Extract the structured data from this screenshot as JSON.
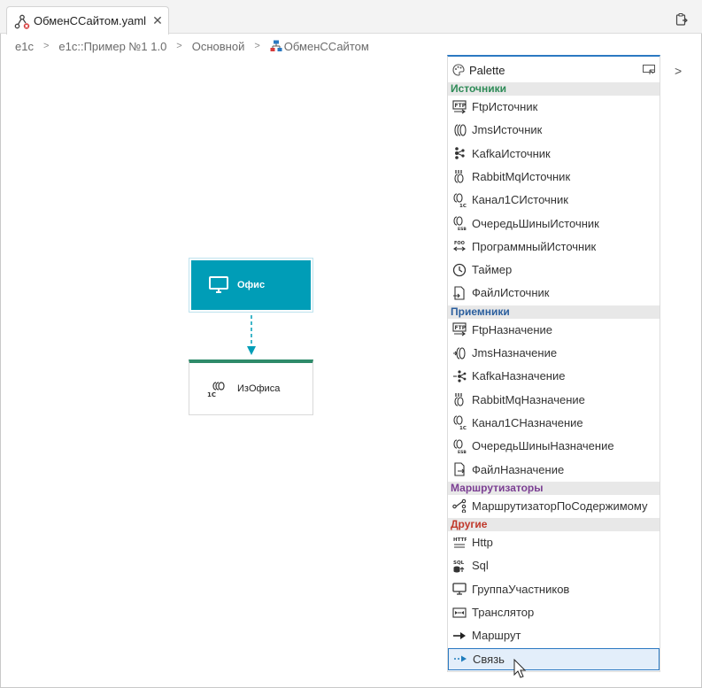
{
  "tab": {
    "title": "ОбменССайтом.yaml",
    "close": "✕"
  },
  "breadcrumb": [
    "e1c",
    "e1c::Пример №1 1.0",
    "Основной",
    "ОбменССайтом"
  ],
  "canvas": {
    "source_node": {
      "label": "Офис",
      "icon": "monitor-icon"
    },
    "dest_node": {
      "label": "ИзОфиса",
      "icon": "1c-channel-destination-icon"
    }
  },
  "palette": {
    "title": "Palette",
    "sections": [
      {
        "title": "Источники",
        "color": "#2e8b57",
        "items": [
          {
            "label": "FtpИсточник",
            "icon": "ftp-source-icon"
          },
          {
            "label": "JmsИсточник",
            "icon": "jms-source-icon"
          },
          {
            "label": "KafkaИсточник",
            "icon": "kafka-source-icon"
          },
          {
            "label": "RabbitMqИсточник",
            "icon": "rabbitmq-source-icon"
          },
          {
            "label": "Канал1СИсточник",
            "icon": "1c-channel-source-icon"
          },
          {
            "label": "ОчередьШиныИсточник",
            "icon": "esb-queue-source-icon"
          },
          {
            "label": "ПрограммныйИсточник",
            "icon": "program-source-icon"
          },
          {
            "label": "Таймер",
            "icon": "timer-icon"
          },
          {
            "label": "ФайлИсточник",
            "icon": "file-source-icon"
          }
        ]
      },
      {
        "title": "Приемники",
        "color": "#2b5f9e",
        "items": [
          {
            "label": "FtpНазначение",
            "icon": "ftp-destination-icon"
          },
          {
            "label": "JmsНазначение",
            "icon": "jms-destination-icon"
          },
          {
            "label": "KafkaНазначение",
            "icon": "kafka-destination-icon"
          },
          {
            "label": "RabbitMqНазначение",
            "icon": "rabbitmq-destination-icon"
          },
          {
            "label": "Канал1СНазначение",
            "icon": "1c-channel-destination-icon"
          },
          {
            "label": "ОчередьШиныНазначение",
            "icon": "esb-queue-destination-icon"
          },
          {
            "label": "ФайлНазначение",
            "icon": "file-destination-icon"
          }
        ]
      },
      {
        "title": "Маршрутизаторы",
        "color": "#7b3f93",
        "items": [
          {
            "label": "МаршрутизаторПоСодержимому",
            "icon": "content-router-icon"
          }
        ]
      },
      {
        "title": "Другие",
        "color": "#c0392b",
        "items": [
          {
            "label": "Http",
            "icon": "http-icon"
          },
          {
            "label": "Sql",
            "icon": "sql-icon"
          },
          {
            "label": "ГруппаУчастников",
            "icon": "participant-group-icon"
          },
          {
            "label": "Транслятор",
            "icon": "translator-icon"
          },
          {
            "label": "Маршрут",
            "icon": "route-arrow-icon"
          },
          {
            "label": "Связь",
            "icon": "link-dashed-arrow-icon",
            "selected": true
          }
        ]
      }
    ]
  },
  "colors": {
    "accent": "#2b79c2",
    "node_fill": "#009db7",
    "dest_border": "#2e8b6a",
    "edge": "#009db7"
  }
}
